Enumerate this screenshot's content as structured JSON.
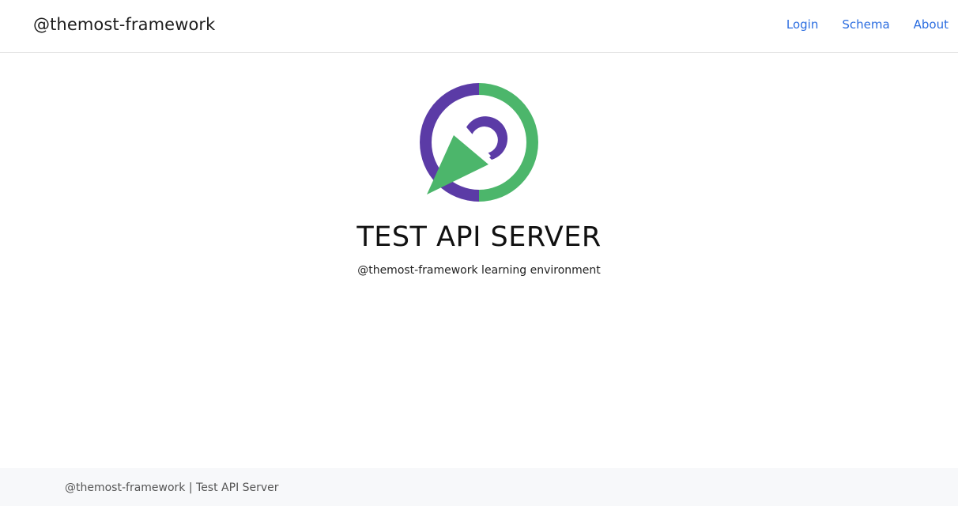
{
  "navbar": {
    "brand": "@themost-framework",
    "links": [
      {
        "label": "Login"
      },
      {
        "label": "Schema"
      },
      {
        "label": "About"
      }
    ]
  },
  "hero": {
    "logo_icon": "themost-logo-icon",
    "title": "TEST API SERVER",
    "subtitle": "@themost-framework learning environment"
  },
  "footer": {
    "text": "@themost-framework | Test API Server"
  },
  "colors": {
    "purple": "#5b3ba6",
    "green": "#4cb66b",
    "link": "#2b6de0"
  }
}
